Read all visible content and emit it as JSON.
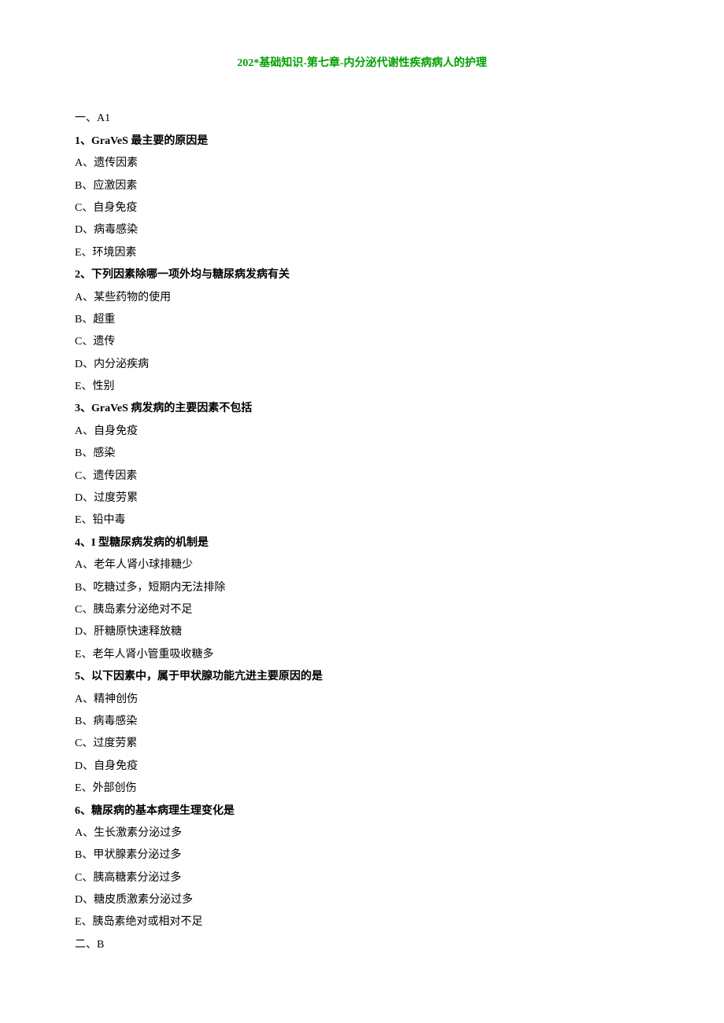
{
  "title": "202*基础知识-第七章-内分泌代谢性疾病病人的护理",
  "section1_header": "一、A1",
  "questions": [
    {
      "stem": "1、GraVeS 最主要的原因是",
      "options": [
        "A、遗传因素",
        "B、应激因素",
        "C、自身免疫",
        "D、病毒感染",
        "E、环境因素"
      ]
    },
    {
      "stem": "2、下列因素除哪一项外均与糖尿病发病有关",
      "options": [
        "A、某些药物的使用",
        "B、超重",
        "C、遗传",
        "D、内分泌疾病",
        "E、性别"
      ]
    },
    {
      "stem": "3、GraVeS 病发病的主要因素不包括",
      "options": [
        "A、自身免疫",
        "B、感染",
        "C、遗传因素",
        "D、过度劳累",
        "E、铅中毒"
      ]
    },
    {
      "stem": "4、I 型糖尿病发病的机制是",
      "options": [
        "A、老年人肾小球排糖少",
        "B、吃糖过多，短期内无法排除",
        "C、胰岛素分泌绝对不足",
        "D、肝糖原快速释放糖",
        "E、老年人肾小管重吸收糖多"
      ]
    },
    {
      "stem": "5、以下因素中，属于甲状腺功能亢进主要原因的是",
      "options": [
        "A、精神创伤",
        "B、病毒感染",
        "C、过度劳累",
        "D、自身免疫",
        "E、外部创伤"
      ]
    },
    {
      "stem": "6、糖尿病的基本病理生理变化是",
      "options": [
        "A、生长激素分泌过多",
        "B、甲状腺素分泌过多",
        "C、胰高糖素分泌过多",
        "D、糖皮质激素分泌过多",
        "E、胰岛素绝对或相对不足"
      ]
    }
  ],
  "section2_header": "二、B"
}
